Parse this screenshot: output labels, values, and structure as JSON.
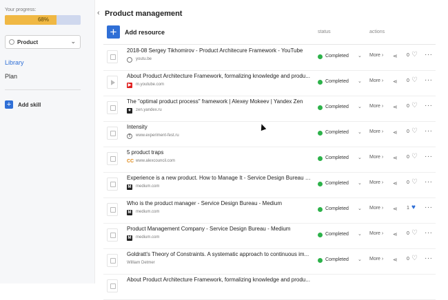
{
  "sidebar": {
    "progress_label": "Your progress:",
    "progress_value": 0.68,
    "progress_text": "68%",
    "colors": {
      "progress_fill": "#f0b844",
      "progress_track": "#cfd8ee",
      "accent": "#2f6fd6"
    },
    "select_value": "Product",
    "nav": [
      {
        "label": "Library",
        "active": true
      },
      {
        "label": "Plan",
        "active": false
      }
    ],
    "add_skill": "Add skill"
  },
  "header": {
    "title": "Product management"
  },
  "toolbar": {
    "add_resource": "Add resource",
    "col_status": "status",
    "col_actions": "actions"
  },
  "rows": [
    {
      "title": "2018-08 Sergey Tikhomirov - Product Architecure Framework - YouTube",
      "source": "youtu.be",
      "source_icon": "globe-icon",
      "thumb": "doc",
      "status": "Completed",
      "more": "More",
      "likes": "0",
      "liked": false
    },
    {
      "title": "About Product Architecture Framework, formalizing knowledge and produ...",
      "source": "m.youtube.com",
      "source_icon": "youtube-icon",
      "thumb": "play",
      "status": "Completed",
      "more": "More",
      "likes": "0",
      "liked": false
    },
    {
      "title": "The \"optimal product process\" framework | Alexey Mokeev | Yandex Zen",
      "source": "zen.yandex.ru",
      "source_icon": "yandex-zen-icon",
      "thumb": "doc",
      "status": "Completed",
      "more": "More",
      "likes": "0",
      "liked": false
    },
    {
      "title": "Intensity",
      "source": "www.experiment-fest.ru",
      "source_icon": "experiment-fest-icon",
      "thumb": "doc",
      "status": "Completed",
      "more": "More",
      "likes": "0",
      "liked": false
    },
    {
      "title": "5 product traps",
      "source": "www.alexcouncil.com",
      "source_icon": "cc-icon",
      "thumb": "doc",
      "status": "Completed",
      "more": "More",
      "likes": "0",
      "liked": false
    },
    {
      "title": "Experience is a new product. How to Manage It - Service Design Bureau - ...",
      "source": "medium.com",
      "source_icon": "medium-icon",
      "thumb": "doc",
      "status": "Completed",
      "more": "More",
      "likes": "0",
      "liked": false
    },
    {
      "title": "Who is the product manager - Service Design Bureau - Medium",
      "source": "medium.com",
      "source_icon": "medium-icon",
      "thumb": "doc",
      "status": "Completed",
      "more": "More",
      "likes": "1",
      "liked": true
    },
    {
      "title": "Product Management Company - Service Design Bureau - Medium",
      "source": "medium.com",
      "source_icon": "medium-icon",
      "thumb": "doc",
      "status": "Completed",
      "more": "More",
      "likes": "0",
      "liked": false
    },
    {
      "title": "Goldratt's Theory of Constraints. A systematic approach to continuous im...",
      "source": "William Detmer",
      "source_icon": "none",
      "thumb": "book",
      "status": "Completed",
      "more": "More",
      "likes": "0",
      "liked": false
    },
    {
      "title": "About Product Architecture Framework, formalizing knowledge and produ...",
      "source": "",
      "source_icon": "none",
      "thumb": "doc",
      "status": "",
      "more": "",
      "likes": "",
      "liked": false
    }
  ]
}
